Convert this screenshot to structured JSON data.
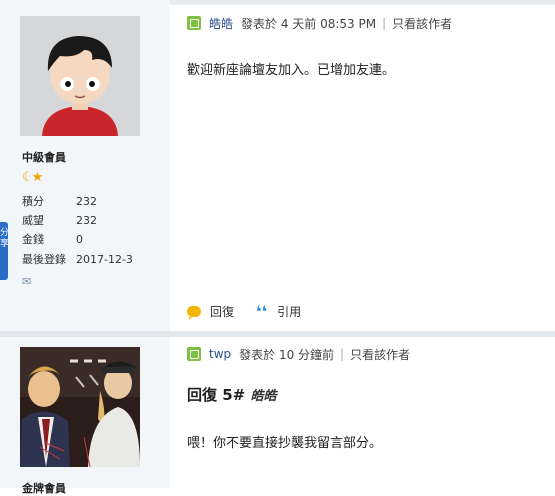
{
  "post1": {
    "rank": "中級會員",
    "stats": [
      {
        "key": "積分",
        "value": "232"
      },
      {
        "key": "威望",
        "value": "232"
      },
      {
        "key": "金錢",
        "value": "0"
      },
      {
        "key": "最後登錄",
        "value": "2017-12-3"
      }
    ],
    "author": "皓皓",
    "posted": "發表於 4 天前 08:53 PM",
    "author_only": "只看該作者",
    "content": "歡迎新座論壇友加入。已增加友連。",
    "actions": {
      "reply": "回復",
      "quote": "引用"
    }
  },
  "post2": {
    "rank": "金牌會員",
    "author": "twp",
    "posted": "發表於 10 分鐘前",
    "author_only": "只看該作者",
    "reply_label": "回復 5#",
    "reply_to": "皓皓",
    "content": "喂！你不要直接抄襲我留言部分。"
  },
  "share_tab": "分享",
  "colors": {
    "online": "#7ec143",
    "link": "#2a4d8c",
    "quote": "#2d8ee0",
    "reply": "#f2b705",
    "share": "#2b6cc4"
  }
}
